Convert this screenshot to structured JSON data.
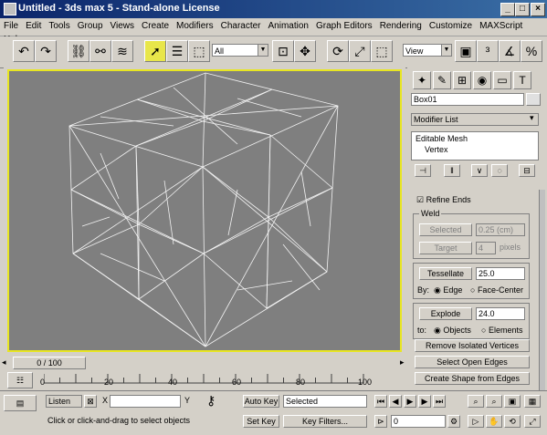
{
  "window": {
    "title": "Untitled - 3ds max 5 - Stand-alone License",
    "min_label": "_",
    "max_label": "□",
    "close_label": "×"
  },
  "menu": [
    "File",
    "Edit",
    "Tools",
    "Group",
    "Views",
    "Create",
    "Modifiers",
    "Character",
    "Animation",
    "Graph Editors",
    "Rendering",
    "Customize",
    "MAXScript",
    "Help"
  ],
  "toolbar": {
    "selection_filter": "All",
    "coord_system": "View"
  },
  "viewport": {
    "frame_counter": "0 / 100"
  },
  "command_panel": {
    "object_name": "Box01",
    "modifier_list": "Modifier List",
    "stack_items": [
      "Editable Mesh",
      "Vertex"
    ],
    "refine_ends": "Refine Ends",
    "weld_group": "Weld",
    "selected_btn": "Selected",
    "selected_value": "0.25 (cm)",
    "target_btn": "Target",
    "target_value": "4",
    "target_unit": "pixels",
    "tessellate_btn": "Tessellate",
    "tessellate_value": "25.0",
    "by_label": "By:",
    "edge_label": "Edge",
    "face_center_label": "Face-Center",
    "explode_btn": "Explode",
    "explode_value": "24.0",
    "to_label": "to:",
    "objects_label": "Objects",
    "elements_label": "Elements",
    "remove_isolated_btn": "Remove Isolated Vertices",
    "select_open_edges_btn": "Select Open Edges",
    "create_shape_btn": "Create Shape from Edges"
  },
  "timeline": {
    "ticks": [
      "0",
      "20",
      "40",
      "60",
      "80",
      "100"
    ]
  },
  "status": {
    "listener": "Listen",
    "x_label": "X",
    "y_label": "Y",
    "prompt": "Click or click-and-drag to select objects",
    "auto_key": "Auto Key",
    "set_key": "Set Key",
    "selected_dd": "Selected",
    "key_filters": "Key Filters...",
    "frame_value": "0"
  },
  "colors": {
    "viewport_bg": "#7f7f7f",
    "viewport_border": "#e8e622",
    "wire": "#ffffff",
    "titlebar": "#0a246a"
  }
}
